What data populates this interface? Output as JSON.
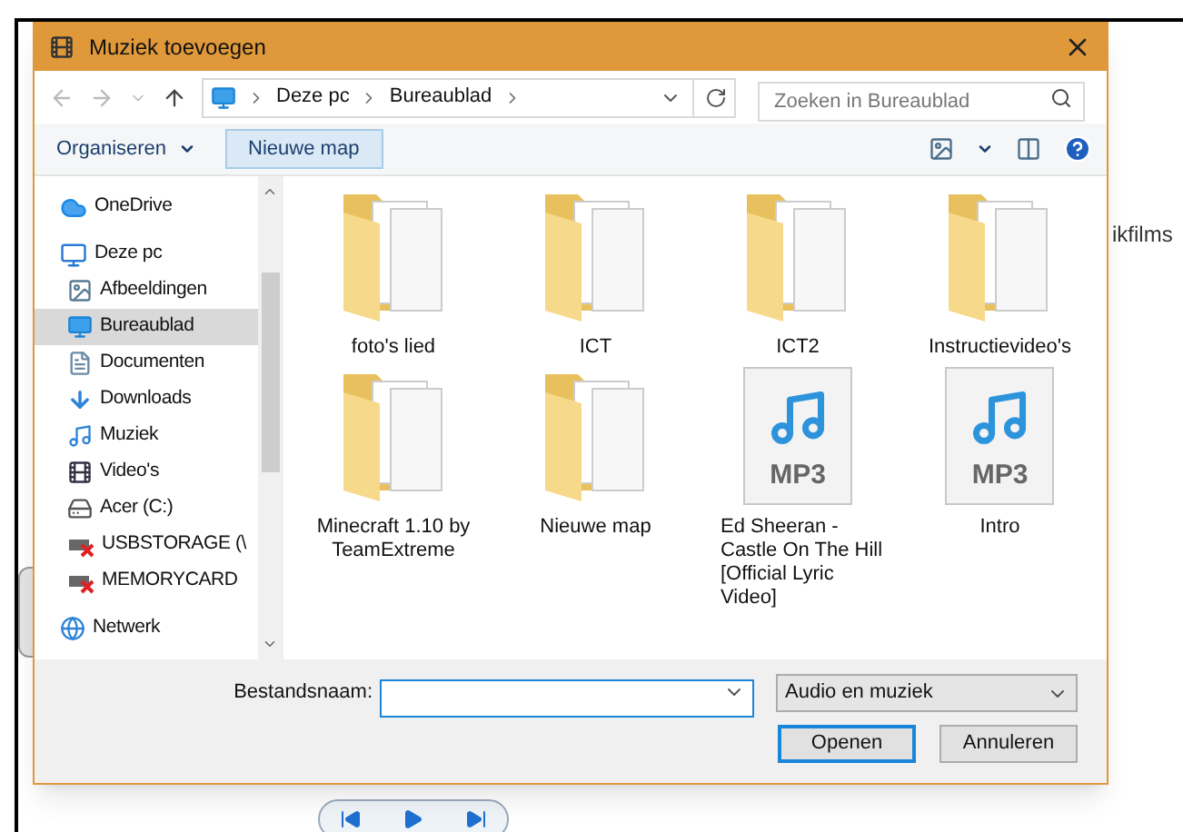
{
  "window": {
    "title": "Muziek toevoegen"
  },
  "breadcrumb": [
    "Deze pc",
    "Bureaublad"
  ],
  "search": {
    "placeholder": "Zoeken in Bureaublad"
  },
  "toolbar": {
    "organize": "Organiseren",
    "new_folder": "Nieuwe map"
  },
  "sidebar": {
    "items": [
      {
        "label": "OneDrive",
        "kind": "cloud",
        "selected": false
      },
      {
        "label": "Deze pc",
        "kind": "pc",
        "selected": false,
        "children": [
          {
            "label": "Afbeeldingen",
            "kind": "pictures",
            "selected": false
          },
          {
            "label": "Bureaublad",
            "kind": "desktop",
            "selected": true
          },
          {
            "label": "Documenten",
            "kind": "documents",
            "selected": false
          },
          {
            "label": "Downloads",
            "kind": "downloads",
            "selected": false
          },
          {
            "label": "Muziek",
            "kind": "music",
            "selected": false
          },
          {
            "label": "Video's",
            "kind": "videos",
            "selected": false
          },
          {
            "label": "Acer (C:)",
            "kind": "drive",
            "selected": false
          },
          {
            "label": "USBSTORAGE (\\",
            "kind": "drive_error",
            "selected": false
          },
          {
            "label": "MEMORYCARD",
            "kind": "drive_error",
            "selected": false
          }
        ]
      },
      {
        "label": "Netwerk",
        "kind": "network",
        "selected": false
      }
    ]
  },
  "files": [
    {
      "name": "foto's lied",
      "kind": "folder"
    },
    {
      "name": "ICT",
      "kind": "folder"
    },
    {
      "name": "ICT2",
      "kind": "folder"
    },
    {
      "name": "Instructievideo's",
      "kind": "folder"
    },
    {
      "name": "Minecraft 1.10 by TeamExtreme",
      "kind": "folder"
    },
    {
      "name": "Nieuwe map",
      "kind": "folder"
    },
    {
      "name": "Ed Sheeran - Castle On The Hill [Official Lyric Video]",
      "kind": "mp3",
      "badge": "MP3"
    },
    {
      "name": "Intro",
      "kind": "mp3",
      "badge": "MP3"
    }
  ],
  "filename": {
    "label": "Bestandsnaam:"
  },
  "filter": {
    "value": "Audio en muziek"
  },
  "buttons": [
    "Openen",
    "Annuleren"
  ],
  "background": {
    "tab_label": "ikfilms"
  }
}
